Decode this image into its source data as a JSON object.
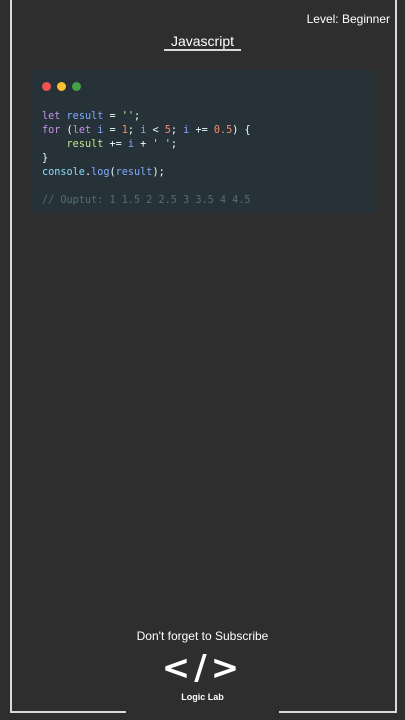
{
  "header": {
    "level": "Level: Beginner",
    "title": "Javascript"
  },
  "code_window": {
    "lines": [
      [
        {
          "t": "let",
          "c": "kw"
        },
        {
          "t": " ",
          "c": "plain"
        },
        {
          "t": "result",
          "c": "var"
        },
        {
          "t": " = ",
          "c": "plain"
        },
        {
          "t": "''",
          "c": "str"
        },
        {
          "t": ";",
          "c": "plain"
        }
      ],
      [
        {
          "t": "for",
          "c": "kw"
        },
        {
          "t": " (",
          "c": "plain"
        },
        {
          "t": "let",
          "c": "kw"
        },
        {
          "t": " ",
          "c": "plain"
        },
        {
          "t": "i",
          "c": "var"
        },
        {
          "t": " = ",
          "c": "plain"
        },
        {
          "t": "1",
          "c": "num"
        },
        {
          "t": "; ",
          "c": "plain"
        },
        {
          "t": "i",
          "c": "var"
        },
        {
          "t": " < ",
          "c": "plain"
        },
        {
          "t": "5",
          "c": "num"
        },
        {
          "t": "; ",
          "c": "plain"
        },
        {
          "t": "i",
          "c": "var"
        },
        {
          "t": " += ",
          "c": "plain"
        },
        {
          "t": "0.5",
          "c": "num"
        },
        {
          "t": ") {",
          "c": "plain"
        }
      ],
      [
        {
          "t": "    ",
          "c": "plain"
        },
        {
          "t": "result",
          "c": "str"
        },
        {
          "t": " += ",
          "c": "plain"
        },
        {
          "t": "i",
          "c": "var"
        },
        {
          "t": " + ",
          "c": "plain"
        },
        {
          "t": "' '",
          "c": "str"
        },
        {
          "t": ";",
          "c": "plain"
        }
      ],
      [
        {
          "t": "}",
          "c": "plain"
        }
      ],
      [
        {
          "t": "console",
          "c": "obj"
        },
        {
          "t": ".",
          "c": "plain"
        },
        {
          "t": "log",
          "c": "fn"
        },
        {
          "t": "(",
          "c": "plain"
        },
        {
          "t": "result",
          "c": "var"
        },
        {
          "t": ");",
          "c": "plain"
        }
      ],
      [],
      [
        {
          "t": "// Ouptut: 1 1.5 2 2.5 3 3.5 4 4.5",
          "c": "comment"
        }
      ]
    ]
  },
  "footer": {
    "subscribe": "Don't forget to Subscribe",
    "logo_mark": "</>",
    "logo_text": "Logic Lab"
  },
  "colors": {
    "background": "#2e2e2e",
    "code_bg": "#263238",
    "dot_red": "#ef5350",
    "dot_yellow": "#fbc02d",
    "dot_green": "#43a047"
  }
}
